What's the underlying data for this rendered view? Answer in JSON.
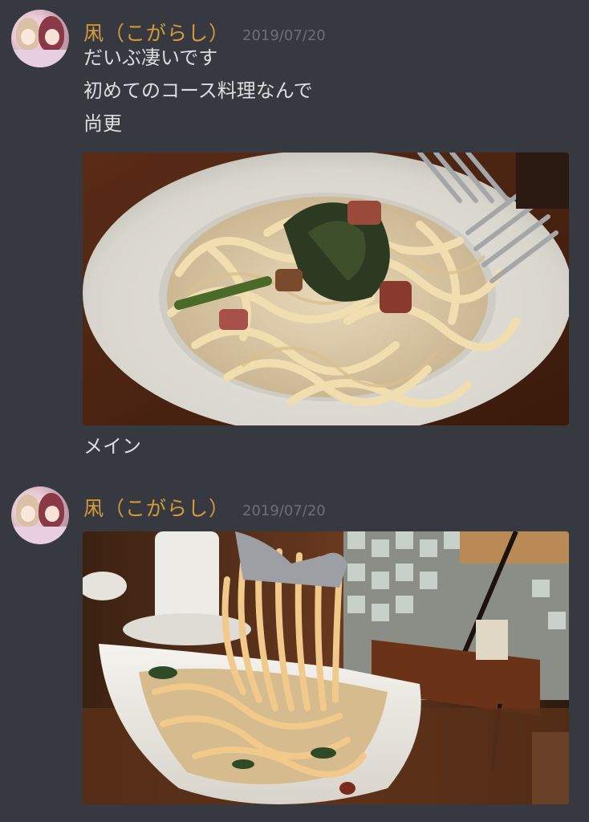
{
  "messages": [
    {
      "username": "凩（こがらし）",
      "timestamp": "2019/07/20",
      "lines": [
        "だいぶ凄いです",
        "初めてのコース料理なんで",
        "尚更"
      ],
      "caption": "メイン"
    },
    {
      "username": "凩（こがらし）",
      "timestamp": "2019/07/20"
    }
  ],
  "colors": {
    "background": "#36393f",
    "username": "#d69a3a",
    "timestamp": "#6c6f76",
    "text": "#dcddde"
  }
}
